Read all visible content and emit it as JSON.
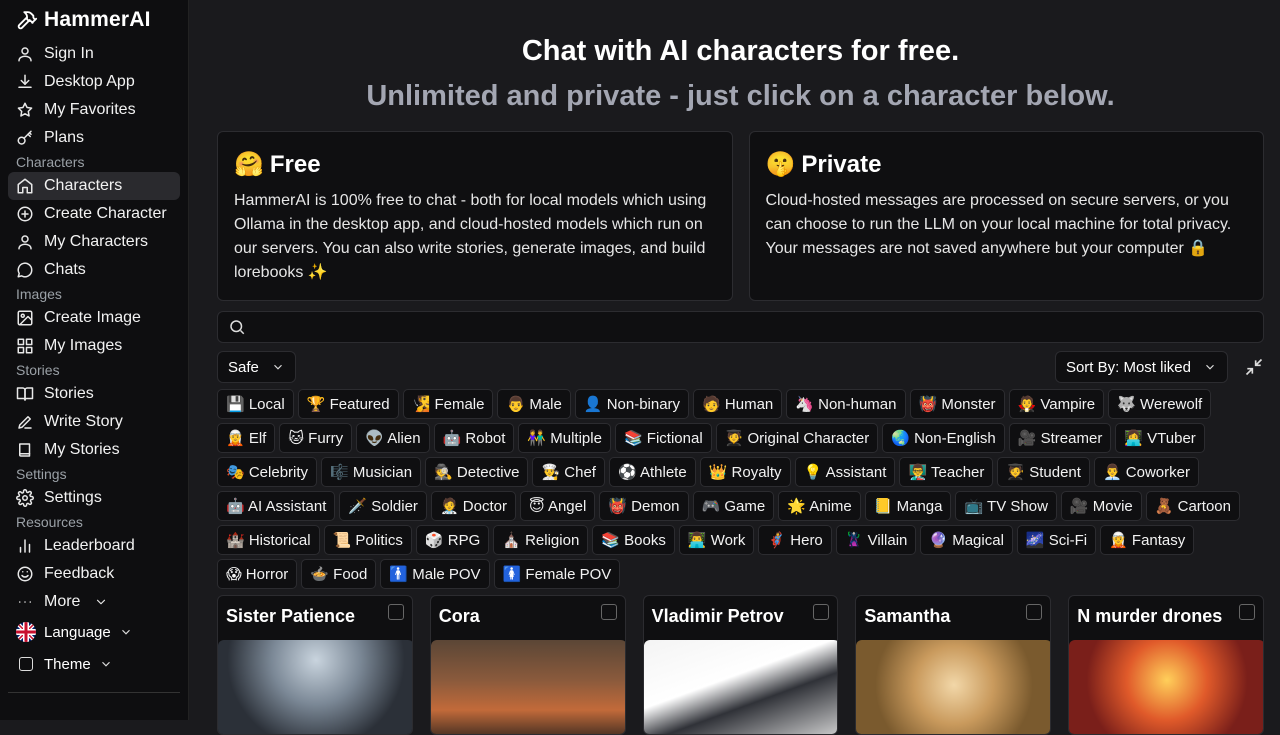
{
  "brand": {
    "name": "HammerAI"
  },
  "sidebar": {
    "top_items": [
      {
        "label": "Sign In",
        "icon": "user-icon"
      },
      {
        "label": "Desktop App",
        "icon": "download-icon"
      },
      {
        "label": "My Favorites",
        "icon": "star-icon"
      },
      {
        "label": "Plans",
        "icon": "key-icon"
      }
    ],
    "sections": {
      "characters": "Characters",
      "images": "Images",
      "stories": "Stories",
      "settings": "Settings",
      "resources": "Resources"
    },
    "character_items": [
      {
        "label": "Characters",
        "icon": "home-icon"
      },
      {
        "label": "Create Character",
        "icon": "plus-circle-icon"
      },
      {
        "label": "My Characters",
        "icon": "user-icon"
      },
      {
        "label": "Chats",
        "icon": "message-icon"
      }
    ],
    "image_items": [
      {
        "label": "Create Image",
        "icon": "image-icon"
      },
      {
        "label": "My Images",
        "icon": "grid-icon"
      }
    ],
    "story_items": [
      {
        "label": "Stories",
        "icon": "book-open-icon"
      },
      {
        "label": "Write Story",
        "icon": "pen-icon"
      },
      {
        "label": "My Stories",
        "icon": "book-icon"
      }
    ],
    "settings_items": [
      {
        "label": "Settings",
        "icon": "gear-icon"
      }
    ],
    "resource_items": [
      {
        "label": "Leaderboard",
        "icon": "bar-chart-icon"
      },
      {
        "label": "Feedback",
        "icon": "smile-icon"
      },
      {
        "label": "More",
        "icon": "dots-icon"
      }
    ],
    "language_label": "Language",
    "theme_label": "Theme"
  },
  "hero": {
    "title": "Chat with AI characters for free.",
    "subtitle": "Unlimited and private - just click on a character below."
  },
  "info_cards": {
    "free": {
      "emoji": "🤗",
      "title": "Free",
      "body": "HammerAI is 100% free to chat - both for local models which using Ollama in the desktop app, and cloud-hosted models which run on our servers. You can also write stories, generate images, and build lorebooks ✨"
    },
    "private": {
      "emoji": "🤫",
      "title": "Private",
      "body": "Cloud-hosted messages are processed on secure servers, or you can choose to run the LLM on your local machine for total privacy. Your messages are not saved anywhere but your computer 🔒"
    }
  },
  "search": {
    "placeholder": "",
    "value": ""
  },
  "filters": {
    "safety": "Safe",
    "sort": "Sort By: Most liked"
  },
  "tags": [
    "💾 Local",
    "🏆 Featured",
    "🧏 Female",
    "👨 Male",
    "👤 Non-binary",
    "🧑 Human",
    "🦄 Non-human",
    "👹 Monster",
    "🧛 Vampire",
    "🐺 Werewolf",
    "🧝 Elf",
    "🐱 Furry",
    "👽 Alien",
    "🤖 Robot",
    "👫 Multiple",
    "📚 Fictional",
    "🧑‍🎓 Original Character",
    "🌏 Non-English",
    "🎥 Streamer",
    "👩‍💻 VTuber",
    "🎭 Celebrity",
    "🎼 Musician",
    "🕵️ Detective",
    "👨‍🍳 Chef",
    "⚽ Athlete",
    "👑 Royalty",
    "💡 Assistant",
    "👨‍🏫 Teacher",
    "🧑‍🎓 Student",
    "👨‍💼 Coworker",
    "🤖 AI Assistant",
    "🗡️ Soldier",
    "🧑‍⚕️ Doctor",
    "😇 Angel",
    "👹 Demon",
    "🎮 Game",
    "🌟 Anime",
    "📒 Manga",
    "📺 TV Show",
    "🎥 Movie",
    "🧸 Cartoon",
    "🏰 Historical",
    "📜 Politics",
    "🎲 RPG",
    "⛪ Religion",
    "📚 Books",
    "👨‍💻 Work",
    "🦸 Hero",
    "🦹 Villain",
    "🔮 Magical",
    "🌌 Sci-Fi",
    "🧝 Fantasy",
    "😱 Horror",
    "🍲 Food",
    "🚹 Male POV",
    "🚺 Female POV"
  ],
  "characters": [
    {
      "name": "Sister Patience"
    },
    {
      "name": "Cora"
    },
    {
      "name": "Vladimir Petrov"
    },
    {
      "name": "Samantha"
    },
    {
      "name": "N murder drones"
    }
  ],
  "colors": {
    "background": "#1a1a1d",
    "sidebar": "#0e0e10",
    "card": "#0f0f11",
    "subtitle": "#a3a6b2"
  }
}
